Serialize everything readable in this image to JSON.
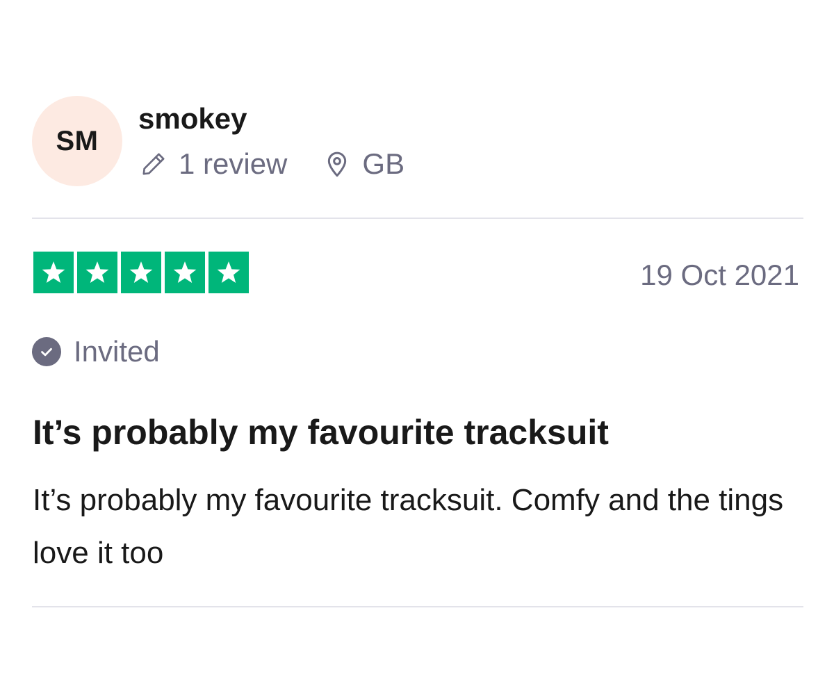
{
  "reviewer": {
    "initials": "SM",
    "name": "smokey",
    "review_count": "1 review",
    "country": "GB",
    "avatar_color": "#fdeae2"
  },
  "icons": {
    "pencil": "pencil-icon",
    "location": "location-pin-icon",
    "star": "star-icon",
    "check": "check-circle-icon"
  },
  "rating": {
    "stars": 5,
    "max": 5,
    "star_color": "#00b67a"
  },
  "review": {
    "date": "19 Oct 2021",
    "status": "Invited",
    "title": "It’s probably my favourite tracksuit",
    "body": "It’s probably my favourite tracksuit. Comfy and the tings love it too"
  }
}
